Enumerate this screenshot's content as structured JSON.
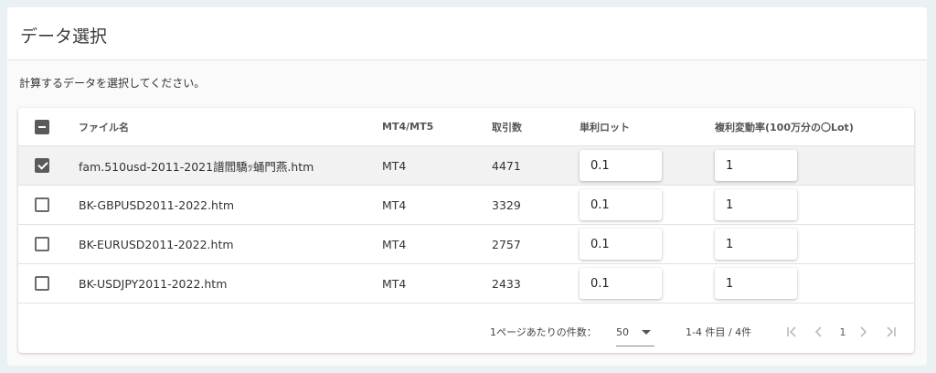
{
  "card": {
    "title": "データ選択",
    "instruction": "計算するデータを選択してください。"
  },
  "table": {
    "headers": {
      "file": "ファイル名",
      "type": "MT4/MT5",
      "trades": "取引数",
      "lot": "単利ロット",
      "rate": "複利変動率(100万分の〇Lot)"
    },
    "header_checkbox_state": "indeterminate",
    "rows": [
      {
        "checked": true,
        "file": "fam.510usd-2011-2021譜閻驕ｯ蛹門燕.htm",
        "type": "MT4",
        "trades": "4471",
        "lot": "0.1",
        "rate": "1"
      },
      {
        "checked": false,
        "file": "BK-GBPUSD2011-2022.htm",
        "type": "MT4",
        "trades": "3329",
        "lot": "0.1",
        "rate": "1"
      },
      {
        "checked": false,
        "file": "BK-EURUSD2011-2022.htm",
        "type": "MT4",
        "trades": "2757",
        "lot": "0.1",
        "rate": "1"
      },
      {
        "checked": false,
        "file": "BK-USDJPY2011-2022.htm",
        "type": "MT4",
        "trades": "2433",
        "lot": "0.1",
        "rate": "1"
      }
    ]
  },
  "paginator": {
    "page_size_label": "1ページあたりの件数：",
    "page_size": "50",
    "range_label": "1-4 件目 / 4件",
    "current_page": "1",
    "icons": {
      "first": "first-page-icon",
      "prev": "chevron-left-icon",
      "next": "chevron-right-icon",
      "last": "last-page-icon"
    }
  }
}
